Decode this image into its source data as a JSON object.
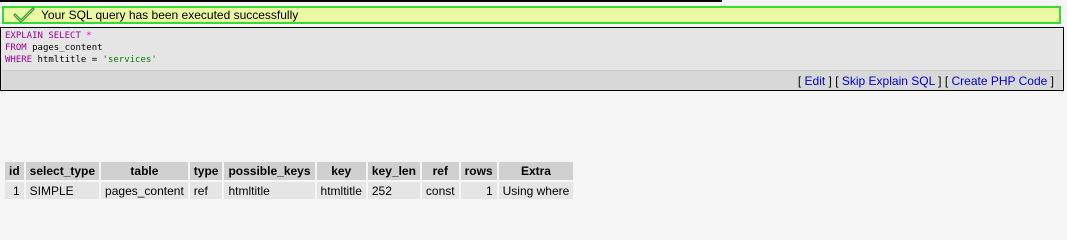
{
  "success": {
    "message": "Your SQL query has been executed successfully"
  },
  "sql": {
    "line1_kw": "EXPLAIN SELECT",
    "line1_op": "*",
    "line2_kw": "FROM",
    "line2_text": "pages_content",
    "line3_kw": "WHERE",
    "line3_text": "htmltitle = ",
    "line3_str": "'services'"
  },
  "links": {
    "edit": "Edit",
    "skip_explain": "Skip Explain SQL",
    "create_php": "Create PHP Code"
  },
  "table": {
    "headers": [
      "id",
      "select_type",
      "table",
      "type",
      "possible_keys",
      "key",
      "key_len",
      "ref",
      "rows",
      "Extra"
    ],
    "rows": [
      [
        "1",
        "SIMPLE",
        "pages_content",
        "ref",
        "htmltitle",
        "htmltitle",
        "252",
        "const",
        "1",
        "Using where"
      ]
    ]
  },
  "colors": {
    "success_border": "#33dd33",
    "success_bg": "#ebf8a4",
    "link": "#0000cc",
    "sql_keyword": "#990099"
  }
}
